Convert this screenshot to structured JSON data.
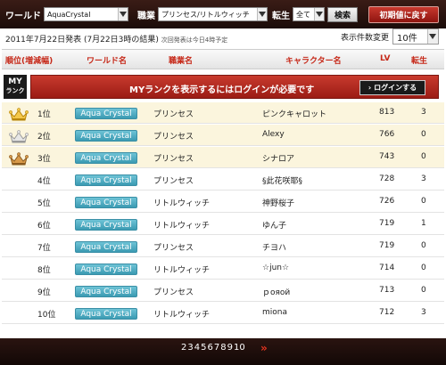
{
  "topbar": {
    "world_label": "ワールド",
    "world_value": "AquaCrystal",
    "job_label": "職業",
    "job_value": "プリンセス/リトルウィッチ",
    "rebirth_label": "転生",
    "rebirth_value": "全て",
    "search_label": "検索",
    "reset_label": "初期値に戻す"
  },
  "publish": {
    "text": "2011年7月22日発表 (7月22日3時の結果)",
    "note": "次回発表は今日4時予定"
  },
  "display_count": {
    "label": "表示件数変更",
    "value": "10件"
  },
  "table_header": {
    "rank": "順位(増減幅)",
    "world": "ワールド名",
    "job": "職業名",
    "character": "キャラクター名",
    "lv": "LV",
    "rebirth": "転生"
  },
  "my_rank": {
    "box_line1": "MY",
    "box_line2": "ランク",
    "message": "MYランクを表示するにはログインが必要です",
    "login_label": "ログインする"
  },
  "rows": [
    {
      "rank": "1位",
      "world": "Aqua Crystal",
      "job": "プリンセス",
      "character": "ピンクキャロット",
      "lv": "813",
      "rebirth": "3",
      "crown": "gold"
    },
    {
      "rank": "2位",
      "world": "Aqua Crystal",
      "job": "プリンセス",
      "character": "Alexy",
      "lv": "766",
      "rebirth": "0",
      "crown": "silver"
    },
    {
      "rank": "3位",
      "world": "Aqua Crystal",
      "job": "プリンセス",
      "character": "シナロア",
      "lv": "743",
      "rebirth": "0",
      "crown": "bronze"
    },
    {
      "rank": "4位",
      "world": "Aqua Crystal",
      "job": "プリンセス",
      "character": "§此花咲耶§",
      "lv": "728",
      "rebirth": "3",
      "crown": ""
    },
    {
      "rank": "5位",
      "world": "Aqua Crystal",
      "job": "リトルウィッチ",
      "character": "神野桜子",
      "lv": "726",
      "rebirth": "0",
      "crown": ""
    },
    {
      "rank": "6位",
      "world": "Aqua Crystal",
      "job": "リトルウィッチ",
      "character": "ゆん子",
      "lv": "719",
      "rebirth": "1",
      "crown": ""
    },
    {
      "rank": "7位",
      "world": "Aqua Crystal",
      "job": "プリンセス",
      "character": "チヨハ",
      "lv": "719",
      "rebirth": "0",
      "crown": ""
    },
    {
      "rank": "8位",
      "world": "Aqua Crystal",
      "job": "リトルウィッチ",
      "character": "☆jun☆",
      "lv": "714",
      "rebirth": "0",
      "crown": ""
    },
    {
      "rank": "9位",
      "world": "Aqua Crystal",
      "job": "プリンセス",
      "character": "ｐояой",
      "lv": "713",
      "rebirth": "0",
      "crown": ""
    },
    {
      "rank": "10位",
      "world": "Aqua Crystal",
      "job": "リトルウィッチ",
      "character": "miona",
      "lv": "712",
      "rebirth": "3",
      "crown": ""
    }
  ],
  "pager": {
    "pages": [
      "2",
      "3",
      "4",
      "5",
      "6",
      "7",
      "8",
      "9",
      "10"
    ],
    "next_icon": "double-chevron-right-icon"
  },
  "colors": {
    "accent_red": "#c62818",
    "gold_row": "#fbf5dd",
    "badge_blue": "#4aa6bd"
  }
}
